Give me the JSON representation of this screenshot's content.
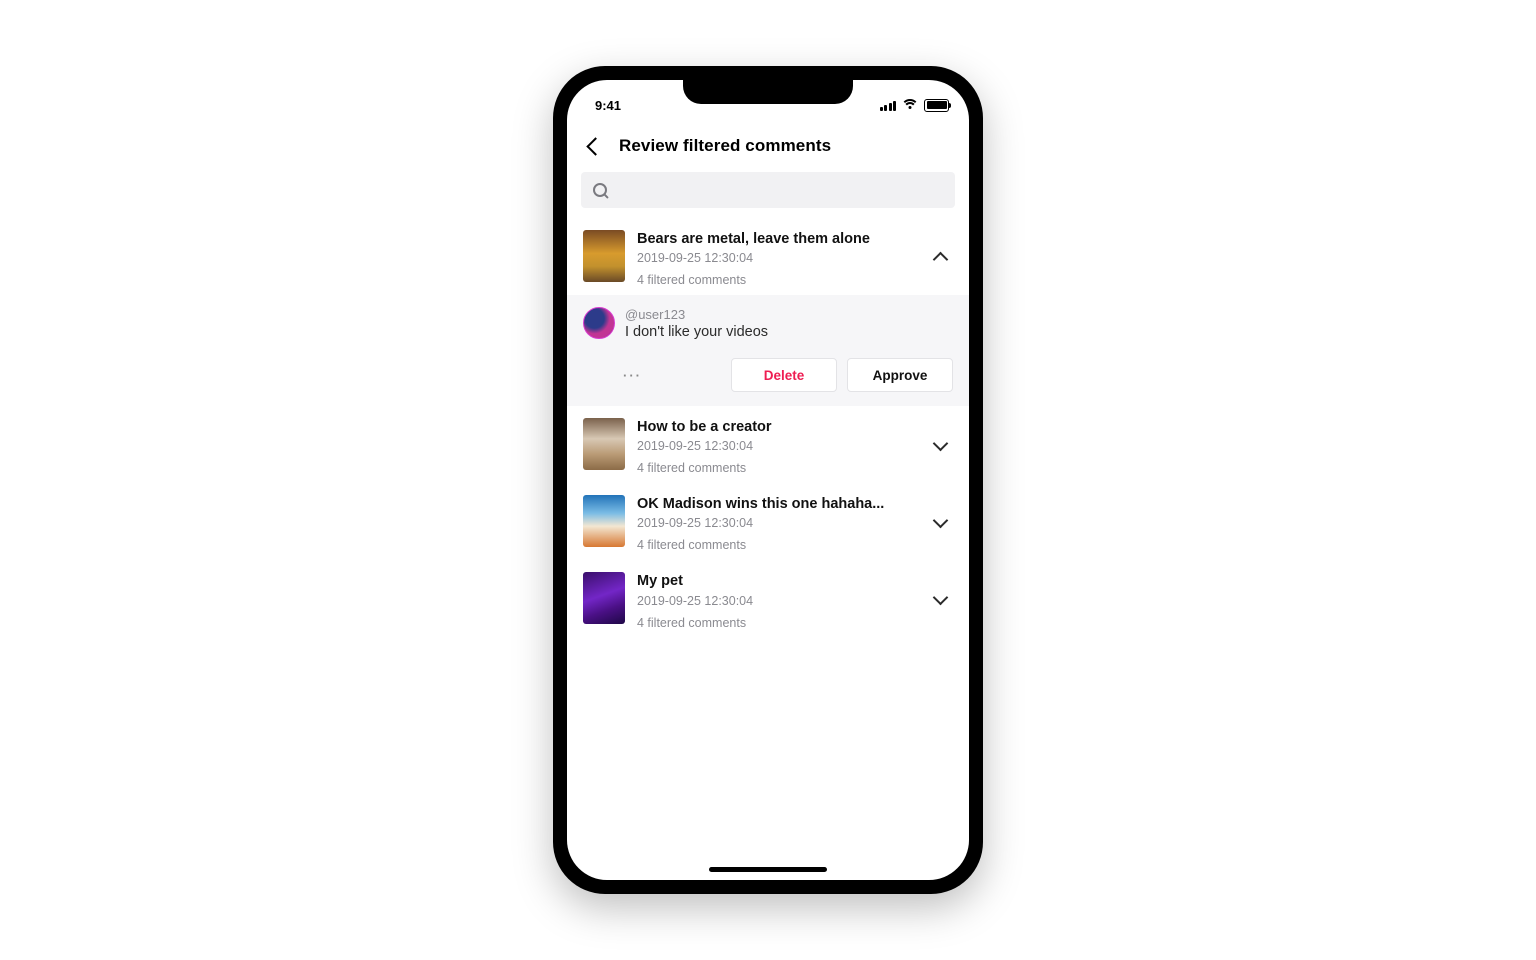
{
  "statusbar": {
    "time": "9:41"
  },
  "header": {
    "title": "Review filtered comments"
  },
  "search": {
    "placeholder": ""
  },
  "videos": [
    {
      "title": "Bears are metal, leave them alone",
      "date": "2019-09-25 12:30:04",
      "filtered_label": "4 filtered comments",
      "expanded": true,
      "comment": {
        "username": "@user123",
        "text": "I don't like your videos",
        "more": "···",
        "delete_label": "Delete",
        "approve_label": "Approve"
      }
    },
    {
      "title": "How to be a creator",
      "date": "2019-09-25 12:30:04",
      "filtered_label": "4 filtered comments",
      "expanded": false
    },
    {
      "title": "OK Madison wins this one hahaha...",
      "date": "2019-09-25 12:30:04",
      "filtered_label": "4 filtered comments",
      "expanded": false
    },
    {
      "title": "My pet",
      "date": "2019-09-25 12:30:04",
      "filtered_label": "4 filtered comments",
      "expanded": false
    }
  ]
}
